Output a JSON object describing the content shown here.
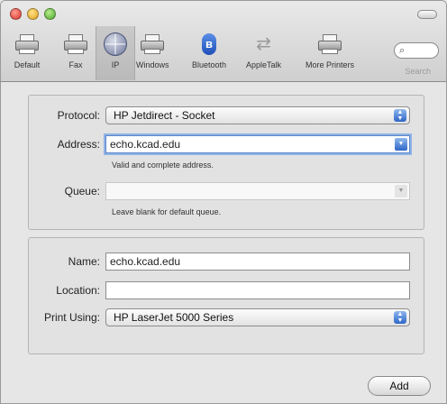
{
  "toolbar": {
    "items": [
      {
        "label": "Default",
        "icon": "printer-icon"
      },
      {
        "label": "Fax",
        "icon": "fax-icon"
      },
      {
        "label": "IP",
        "icon": "globe-icon"
      },
      {
        "label": "Windows",
        "icon": "windows-printer-icon"
      },
      {
        "label": "Bluetooth",
        "icon": "bluetooth-icon",
        "glyph": "ʙ"
      },
      {
        "label": "AppleTalk",
        "icon": "appletalk-icon",
        "glyph": "⇄"
      },
      {
        "label": "More Printers",
        "icon": "more-printers-icon"
      }
    ],
    "search_label": "Search",
    "selected": "IP"
  },
  "connection": {
    "protocol_label": "Protocol:",
    "protocol_value": "HP Jetdirect - Socket",
    "address_label": "Address:",
    "address_value": "echo.kcad.edu",
    "address_hint": "Valid and complete address.",
    "queue_label": "Queue:",
    "queue_value": "",
    "queue_hint": "Leave blank for default queue."
  },
  "details": {
    "name_label": "Name:",
    "name_value": "echo.kcad.edu",
    "location_label": "Location:",
    "location_value": "",
    "print_using_label": "Print Using:",
    "print_using_value": "HP LaserJet 5000 Series"
  },
  "actions": {
    "add_label": "Add"
  },
  "colors": {
    "accent": "#2d66c7",
    "focus_ring": "#8fb3e6"
  }
}
